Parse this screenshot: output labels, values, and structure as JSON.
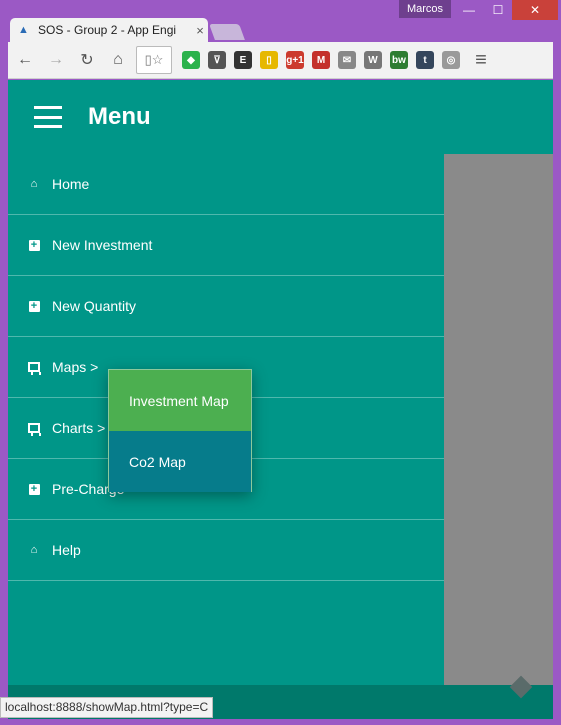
{
  "window": {
    "user": "Marcos",
    "minimize_glyph": "—",
    "maximize_glyph": "☐",
    "close_glyph": "✕"
  },
  "tab": {
    "title": "SOS - Group 2 - App Engi",
    "close_glyph": "×"
  },
  "toolbar": {
    "back_glyph": "←",
    "forward_glyph": "→",
    "reload_glyph": "↻",
    "home_glyph": "⌂",
    "menu_glyph": "≡",
    "extensions": [
      {
        "name": "feedly-icon",
        "label": "◆",
        "color": "#2bb24c"
      },
      {
        "name": "pocket-icon",
        "label": "⊽",
        "color": "#555555"
      },
      {
        "name": "evernote-icon",
        "label": "E",
        "color": "#333333"
      },
      {
        "name": "phone-icon",
        "label": "▯",
        "color": "#e6b800"
      },
      {
        "name": "google-plus-icon",
        "label": "g+1",
        "color": "#cc3b2e"
      },
      {
        "name": "gmail-icon",
        "label": "M",
        "color": "#c4302b"
      },
      {
        "name": "mail-icon",
        "label": "✉",
        "color": "#888888"
      },
      {
        "name": "wikipedia-icon",
        "label": "W",
        "color": "#777777"
      },
      {
        "name": "bw-icon",
        "label": "bw",
        "color": "#2e7d32"
      },
      {
        "name": "tumblr-icon",
        "label": "t",
        "color": "#35465c"
      },
      {
        "name": "steering-icon",
        "label": "◎",
        "color": "#999999"
      }
    ]
  },
  "app": {
    "menu_title": "Menu",
    "nav_items": [
      {
        "label": "Home",
        "icon": "home-icon"
      },
      {
        "label": "New Investment",
        "icon": "plus-square-icon"
      },
      {
        "label": "New Quantity",
        "icon": "plus-square-icon"
      },
      {
        "label": "Maps >",
        "icon": "board-icon"
      },
      {
        "label": "Charts >",
        "icon": "board-icon"
      },
      {
        "label": "Pre-Charge",
        "icon": "plus-square-icon"
      },
      {
        "label": "Help",
        "icon": "home-icon"
      }
    ],
    "submenu": [
      {
        "label": "Investment Map",
        "active": true
      },
      {
        "label": "Co2 Map",
        "active": false
      }
    ]
  },
  "status": {
    "url": "localhost:8888/showMap.html?type=C"
  }
}
